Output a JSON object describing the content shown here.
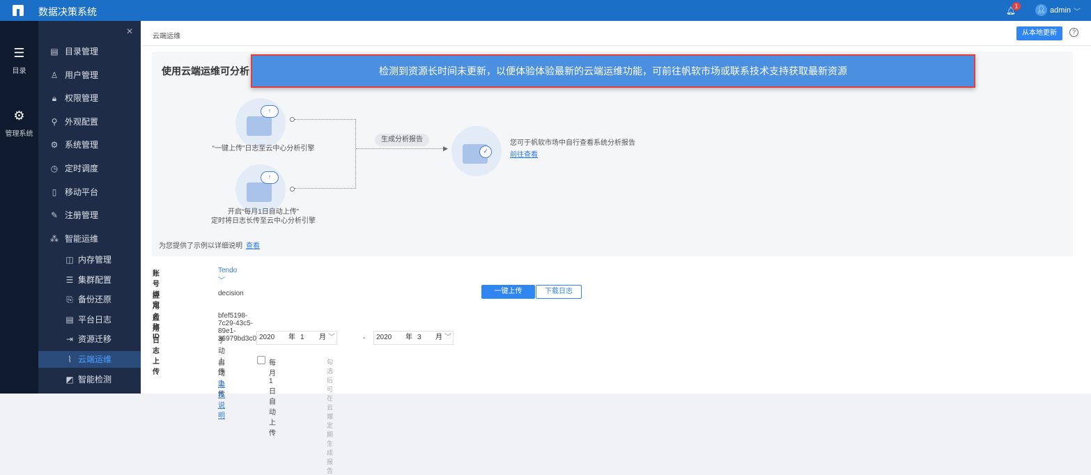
{
  "app": {
    "title": "数据决策系统",
    "notifications": "1",
    "user": "admin"
  },
  "rail": [
    {
      "label": "目录",
      "icon": "list-icon"
    },
    {
      "label": "管理系统",
      "icon": "gear-icon"
    }
  ],
  "menu": [
    {
      "label": "目录管理",
      "icon": "▤"
    },
    {
      "label": "用户管理",
      "icon": "♙"
    },
    {
      "label": "权限管理",
      "icon": "🔒︎"
    },
    {
      "label": "外观配置",
      "icon": "⚲"
    },
    {
      "label": "系统管理",
      "icon": "⚙"
    },
    {
      "label": "定时调度",
      "icon": "◷"
    },
    {
      "label": "移动平台",
      "icon": "▯"
    },
    {
      "label": "注册管理",
      "icon": "✎"
    },
    {
      "label": "智能运维",
      "icon": "⁂"
    }
  ],
  "submenu": [
    {
      "label": "内存管理",
      "icon": "◫"
    },
    {
      "label": "集群配置",
      "icon": "☰"
    },
    {
      "label": "备份还原",
      "icon": "⎘"
    },
    {
      "label": "平台日志",
      "icon": "▤"
    },
    {
      "label": "资源迁移",
      "icon": "⇥"
    },
    {
      "label": "云端运维",
      "icon": "⌇"
    },
    {
      "label": "智能检测",
      "icon": "◩"
    }
  ],
  "breadcrumb": "云端运维",
  "header": {
    "update_local": "从本地更新",
    "help": "?"
  },
  "card": {
    "title": "使用云端运维可分析",
    "banner": "检测到资源长时间未更新，以便体验体验最新的云端运维功能，可前往帆软市场或联系技术支持获取最新资源",
    "step1": "“一键上传”日志至云中心分析引擎",
    "step2a": "开启“每月1日自动上传”",
    "step2b": "定时将日志长传至云中心分析引擎",
    "pill": "生成分析报告",
    "result": "您可于帆软市场中自行查看系统分析报告",
    "result_link": "前往查看",
    "footer": "为您提供了示例以详细说明",
    "footer_link": "查看"
  },
  "form": {
    "account_label": "账号绑定",
    "account_value": "Tendo",
    "app_name_label": "应用名称",
    "app_name_value": "decision",
    "app_id_label": "应用ID",
    "app_id_value": "bfef5198-7c29-43c5-89e1-36979bd3c082",
    "log_label": "日志上传",
    "manual_label": "手动上传",
    "from_year": "2020",
    "from_month": "1",
    "to_year": "2020",
    "to_month": "3",
    "year_unit": "年",
    "month_unit": "月",
    "dash": "-",
    "upload_btn": "一键上传",
    "download_btn": "下载日志",
    "auto_label": "自动上传",
    "auto_checkbox": "每月1日自动上传",
    "auto_hint": "勾选后可在云端定期生成报告",
    "privacy_link": "隐私说明"
  }
}
